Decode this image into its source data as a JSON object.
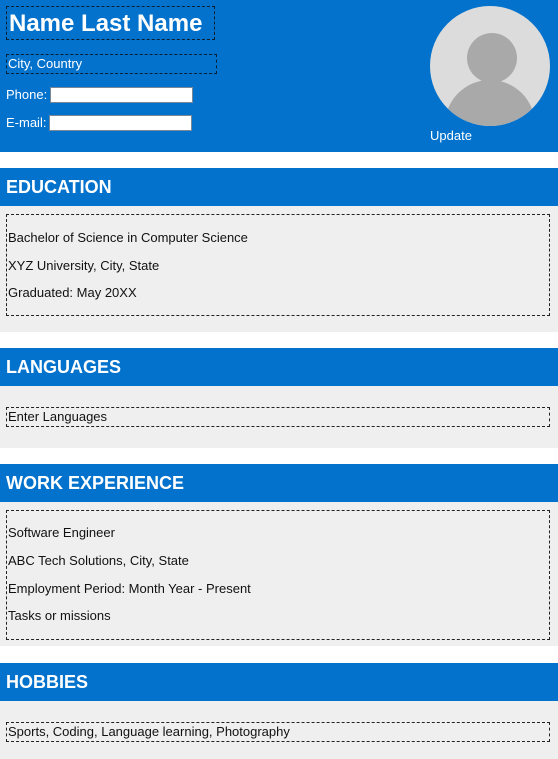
{
  "header": {
    "name": "Name Last Name",
    "location": "City, Country",
    "phone_label": "Phone:",
    "phone_value": "",
    "email_label": "E-mail:",
    "email_value": "",
    "avatar_icon": "user-avatar-icon",
    "update_label": "Update"
  },
  "education": {
    "title": "EDUCATION",
    "lines": [
      "Bachelor of Science in Computer Science",
      "XYZ University, City, State",
      "Graduated: May 20XX"
    ]
  },
  "languages": {
    "title": "LANGUAGES",
    "text": "Enter Languages"
  },
  "work": {
    "title": "WORK EXPERIENCE",
    "lines": [
      "Software Engineer",
      "ABC Tech Solutions, City, State",
      "Employment Period: Month Year - Present",
      "Tasks or missions"
    ]
  },
  "hobbies": {
    "title": "HOBBIES",
    "text": "Sports, Coding, Language learning, Photography"
  },
  "colors": {
    "accent": "#0272cd",
    "panel": "#efefef",
    "text_on_accent": "#ffffff"
  }
}
